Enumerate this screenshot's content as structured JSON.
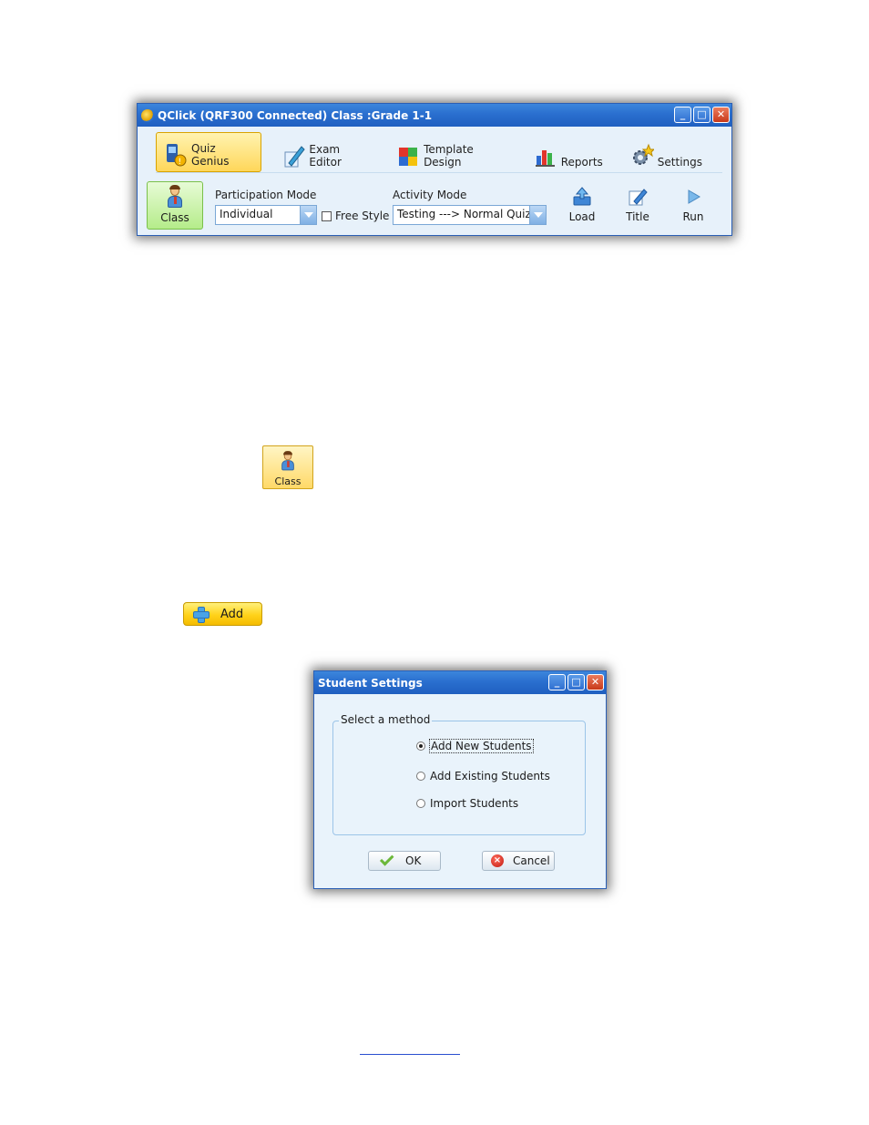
{
  "main_window": {
    "title": "QClick  (QRF300 Connected)  Class :Grade 1-1",
    "tabs": [
      {
        "label": "Quiz Genius"
      },
      {
        "label": "Exam Editor"
      },
      {
        "label": "Template Design"
      },
      {
        "label": "Reports"
      },
      {
        "label": "Settings"
      }
    ],
    "class_label": "Class",
    "participation_mode": {
      "label": "Participation Mode",
      "value": "Individual"
    },
    "free_style_label": "Free Style",
    "activity_mode": {
      "label": "Activity Mode",
      "value": "Testing ---> Normal Quiz"
    },
    "tools": [
      {
        "label": "Load"
      },
      {
        "label": "Title"
      },
      {
        "label": "Run"
      }
    ]
  },
  "class_button": {
    "label": "Class"
  },
  "add_button": {
    "label": "Add"
  },
  "dialog": {
    "title": "Student Settings",
    "group_label": "Select a method",
    "options": [
      {
        "label": "Add New Students"
      },
      {
        "label": "Add Existing Students"
      },
      {
        "label": "Import Students"
      }
    ],
    "ok_label": "OK",
    "cancel_label": "Cancel"
  },
  "window_buttons": {
    "minimize": "_",
    "maximize": "□",
    "close": "✕"
  },
  "colors": {
    "titlebar": "#2a6fcf",
    "active_tab": "#ffd75a",
    "class_green": "#b5ec8a",
    "add_yellow": "#ffd21a"
  }
}
